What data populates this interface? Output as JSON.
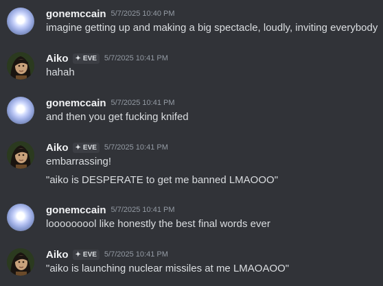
{
  "messages": [
    {
      "author": "gonemccain",
      "tag": "",
      "time": "5/7/2025 10:40 PM",
      "lines": [
        "imagine getting up and making a big spectacle, loudly, inviting everybody"
      ]
    },
    {
      "author": "Aiko",
      "tag": "EVE",
      "time": "5/7/2025 10:41 PM",
      "lines": [
        "hahah"
      ]
    },
    {
      "author": "gonemccain",
      "tag": "",
      "time": "5/7/2025 10:41 PM",
      "lines": [
        "and then you get fucking knifed"
      ]
    },
    {
      "author": "Aiko",
      "tag": "EVE",
      "time": "5/7/2025 10:41 PM",
      "lines": [
        "embarrassing!",
        "\"aiko is DESPERATE to get me banned LMAOOO\""
      ]
    },
    {
      "author": "gonemccain",
      "tag": "",
      "time": "5/7/2025 10:41 PM",
      "lines": [
        "looooooool like honestly the best final words ever"
      ]
    },
    {
      "author": "Aiko",
      "tag": "EVE",
      "time": "5/7/2025 10:41 PM",
      "lines": [
        "\"aiko is launching nuclear missiles at me LMAOAOO\""
      ]
    }
  ],
  "icons": {
    "tag_icon": "sparkle-icon"
  }
}
